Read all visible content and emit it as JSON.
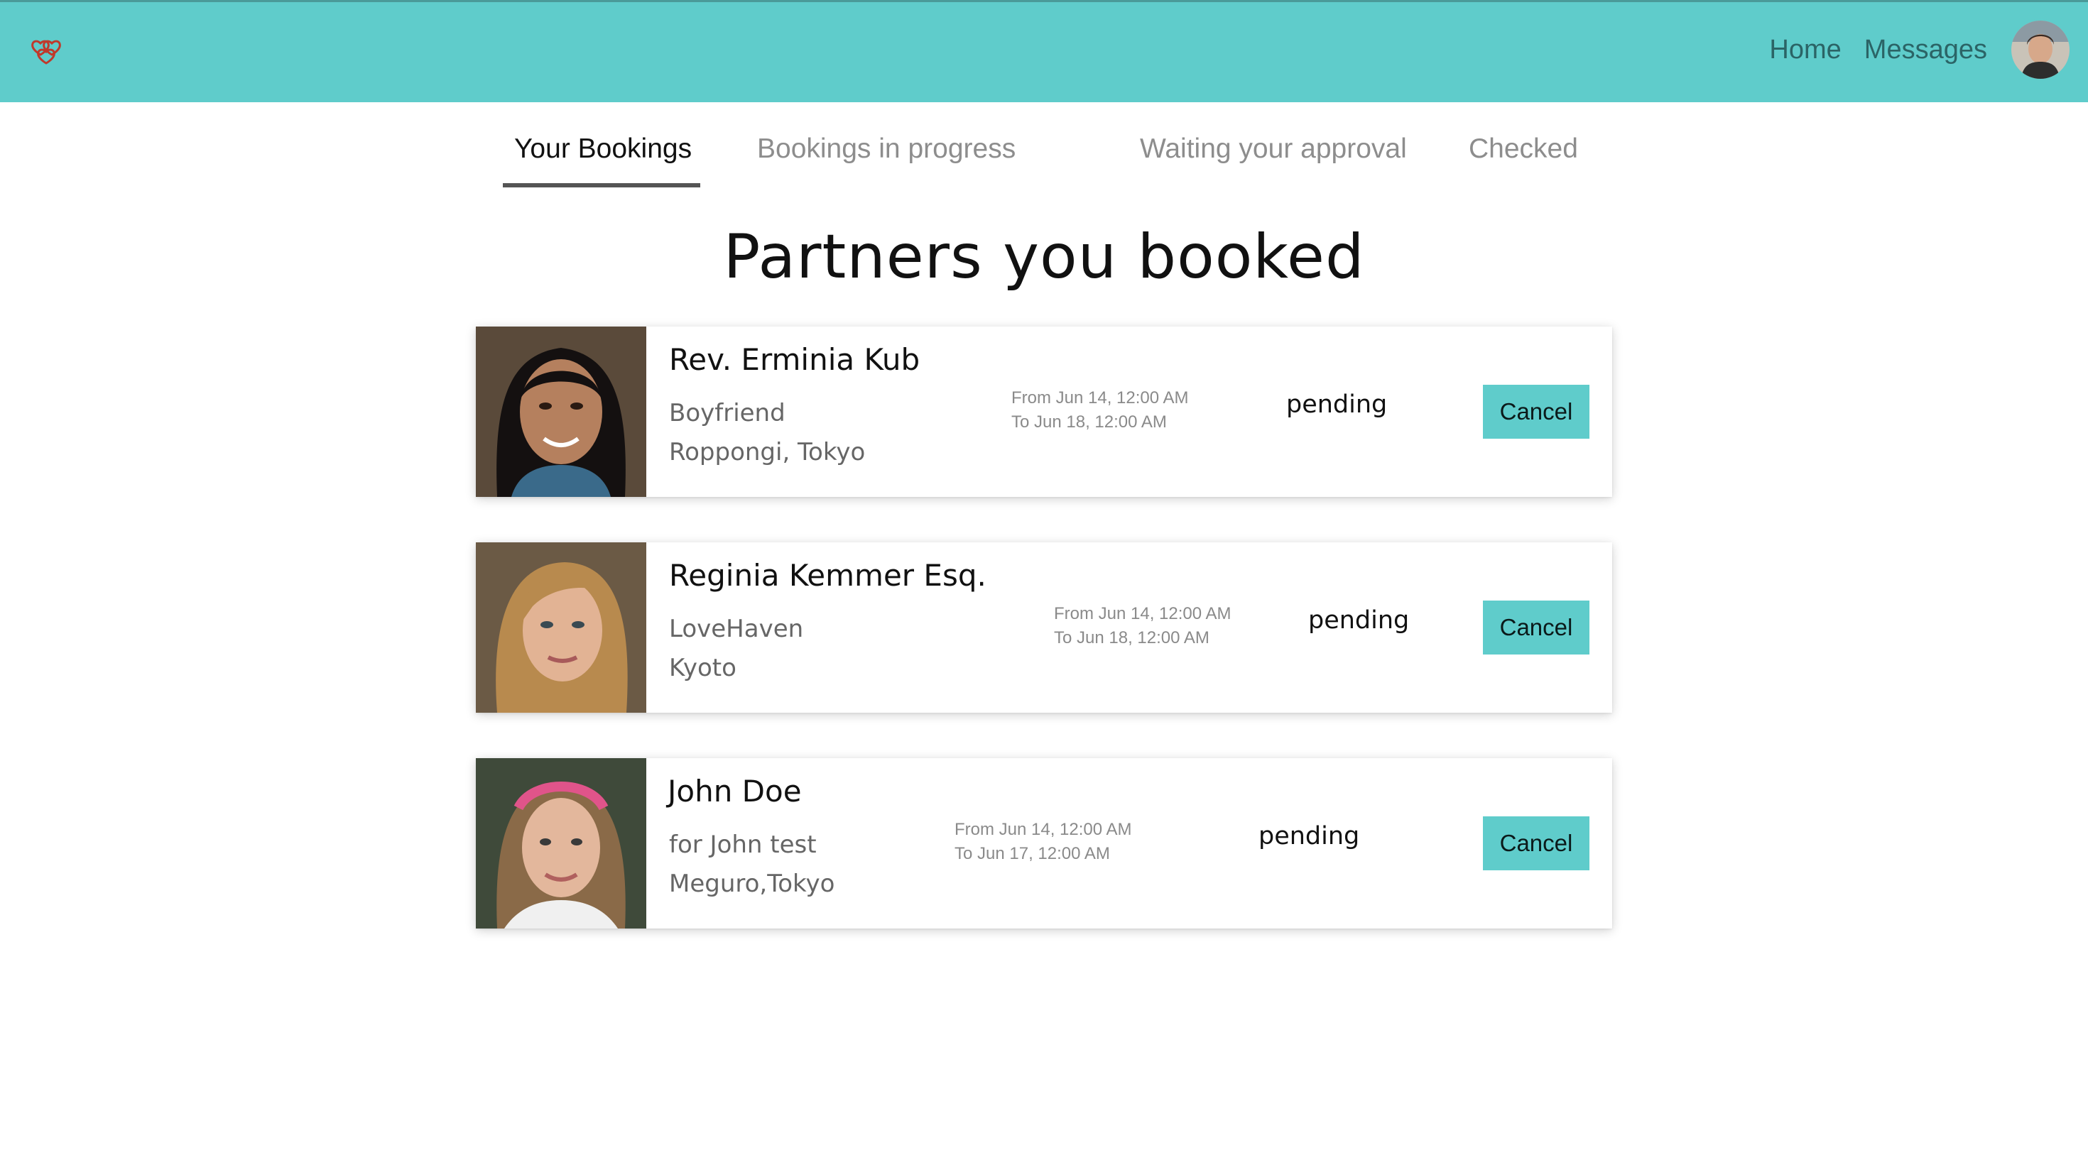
{
  "header": {
    "nav": {
      "home": "Home",
      "messages": "Messages"
    }
  },
  "tabs": [
    {
      "label": "Your Bookings",
      "active": true
    },
    {
      "label": "Bookings in progress",
      "active": false
    },
    {
      "label": "Waiting your approval",
      "active": false
    },
    {
      "label": "Checked",
      "active": false
    }
  ],
  "page_title": "Partners you booked",
  "bookings": [
    {
      "name": "Rev. Erminia Kub",
      "role": "Boyfriend",
      "location": "Roppongi, Tokyo",
      "from": "From Jun 14, 12:00 AM",
      "to": "To Jun 18, 12:00 AM",
      "status": "pending",
      "action": "Cancel"
    },
    {
      "name": "Reginia Kemmer Esq.",
      "role": "LoveHaven",
      "location": "Kyoto",
      "from": "From Jun 14, 12:00 AM",
      "to": "To Jun 18, 12:00 AM",
      "status": "pending",
      "action": "Cancel"
    },
    {
      "name": "John Doe",
      "role": "for John test",
      "location": "Meguro,Tokyo",
      "from": "From Jun 14, 12:00 AM",
      "to": "To Jun 17, 12:00 AM",
      "status": "pending",
      "action": "Cancel"
    }
  ],
  "colors": {
    "accent": "#5fcccb",
    "logo": "#c0392b"
  }
}
